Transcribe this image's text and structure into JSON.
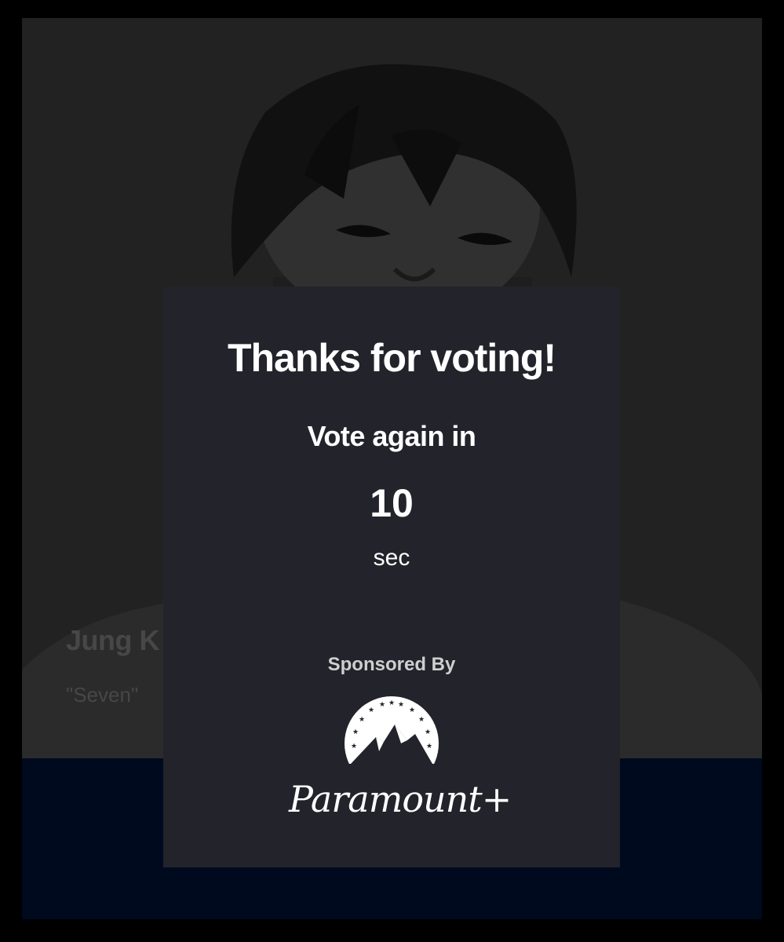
{
  "nominee": {
    "name": "Jung K",
    "song": "\"Seven\""
  },
  "modal": {
    "title": "Thanks for voting!",
    "vote_again_label": "Vote again in",
    "countdown_value": "10",
    "countdown_unit": "sec",
    "sponsored_label": "Sponsored By",
    "sponsor_name": "Paramount+"
  },
  "icons": {
    "sponsor_logo": "paramount-mountain-stars-logo"
  },
  "colors": {
    "modal_bg": "#23232b",
    "page_bg": "#232323",
    "band_bg": "#000a1e",
    "text": "#ffffff",
    "muted_text": "#474747"
  }
}
